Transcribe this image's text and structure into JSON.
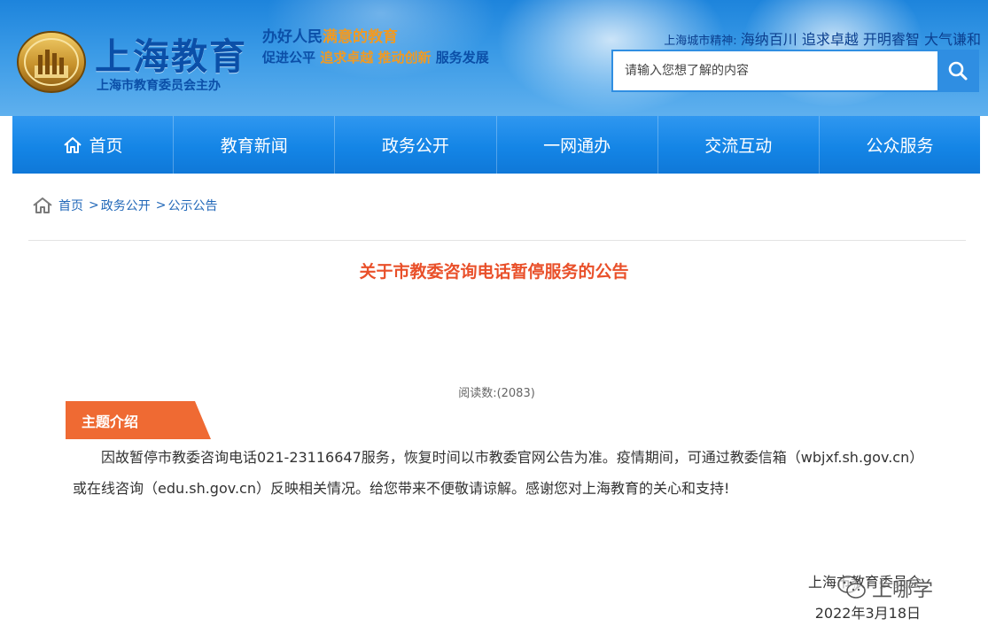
{
  "header": {
    "logo_title": "上海教育",
    "logo_subtitle": "上海市教育委员会主办",
    "slogan_line1": [
      "办好人民",
      "满意的教育"
    ],
    "slogan_line2": [
      "促进公平",
      "追求卓越",
      "推动创新",
      "服务发展"
    ],
    "city_spirit_label": "上海城市精神:",
    "city_spirit_text": "海纳百川 追求卓越 开明睿智 大气谦和",
    "search_placeholder": "请输入您想了解的内容"
  },
  "nav": {
    "items": [
      {
        "label": "首页",
        "icon": "home-icon"
      },
      {
        "label": "教育新闻"
      },
      {
        "label": "政务公开"
      },
      {
        "label": "一网通办"
      },
      {
        "label": "交流互动"
      },
      {
        "label": "公众服务"
      }
    ]
  },
  "breadcrumb": {
    "items": [
      "首页",
      "政务公开",
      "公示公告"
    ],
    "separator": ">"
  },
  "article": {
    "title": "关于市教委咨询电话暂停服务的公告",
    "views": "阅读数:(2083)",
    "topic_label": "主题介绍",
    "body": "因故暂停市教委咨询电话021-23116647服务，恢复时间以市教委官网公告为准。疫情期间，可通过教委信箱（wbjxf.sh.gov.cn）或在线咨询（edu.sh.gov.cn）反映相关情况。给您带来不便敬请谅解。感谢您对上海教育的关心和支持!",
    "signature": "上海市教育委员会",
    "date": "2022年3月18日"
  },
  "watermark": {
    "text": "上哪学",
    "icon": "wechat-icon"
  },
  "colors": {
    "header_blue": "#1d84dc",
    "nav_blue": "#1485e6",
    "title_orange": "#e9502a",
    "tag_orange": "#ef6a33",
    "link_blue": "#2067b8"
  }
}
